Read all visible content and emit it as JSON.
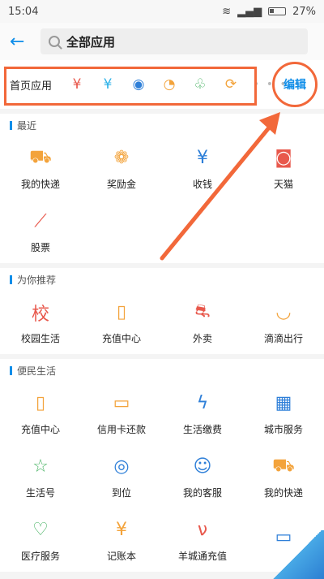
{
  "status_bar": {
    "time": "15:04",
    "battery": "27%"
  },
  "header": {
    "back_icon": "arrow-left-icon",
    "search_text": "全部应用"
  },
  "home_apps": {
    "label": "首页应用",
    "icons": [
      {
        "name": "money-bag-icon",
        "glyph": "¥",
        "color": "#e8584c"
      },
      {
        "name": "transfer-icon",
        "glyph": "¥",
        "color": "#2db2e8"
      },
      {
        "name": "phone-recharge-icon",
        "glyph": "◉",
        "color": "#2e7fd8"
      },
      {
        "name": "bean-icon",
        "glyph": "◔",
        "color": "#f3a33b"
      },
      {
        "name": "sprout-icon",
        "glyph": "♧",
        "color": "#4bb466"
      },
      {
        "name": "delivery-icon",
        "glyph": "⟳",
        "color": "#f3a33b"
      }
    ],
    "dots": "• • • •",
    "edit_label": "编辑"
  },
  "sections": [
    {
      "title": "最近",
      "items": [
        {
          "label": "我的快递",
          "icon": "truck-icon",
          "glyph": "⛟",
          "color": "#f3a33b"
        },
        {
          "label": "奖励金",
          "icon": "award-icon",
          "glyph": "❁",
          "color": "#f3a33b"
        },
        {
          "label": "收钱",
          "icon": "receive-money-icon",
          "glyph": "¥",
          "color": "#2e7fd8"
        },
        {
          "label": "天猫",
          "icon": "tmall-icon",
          "glyph": "◙",
          "color": "#e8584c"
        },
        {
          "label": "股票",
          "icon": "stock-chart-icon",
          "glyph": "⟋",
          "color": "#e8584c"
        }
      ]
    },
    {
      "title": "为你推荐",
      "items": [
        {
          "label": "校园生活",
          "icon": "campus-icon",
          "glyph": "校",
          "color": "#e8584c"
        },
        {
          "label": "充值中心",
          "icon": "phone-recharge-icon",
          "glyph": "▯",
          "color": "#f3a33b"
        },
        {
          "label": "外卖",
          "icon": "scooter-icon",
          "glyph": "⛐",
          "color": "#e8584c"
        },
        {
          "label": "滴滴出行",
          "icon": "didi-icon",
          "glyph": "◡",
          "color": "#f3a33b"
        }
      ]
    },
    {
      "title": "便民生活",
      "items": [
        {
          "label": "充值中心",
          "icon": "phone-recharge-icon",
          "glyph": "▯",
          "color": "#f3a33b"
        },
        {
          "label": "信用卡还款",
          "icon": "credit-card-icon",
          "glyph": "▭",
          "color": "#f3a33b"
        },
        {
          "label": "生活缴费",
          "icon": "utility-drop-icon",
          "glyph": "ϟ",
          "color": "#2e7fd8"
        },
        {
          "label": "城市服务",
          "icon": "building-icon",
          "glyph": "▦",
          "color": "#2e7fd8"
        },
        {
          "label": "生活号",
          "icon": "life-account-icon",
          "glyph": "☆",
          "color": "#4bb466"
        },
        {
          "label": "到位",
          "icon": "location-icon",
          "glyph": "◎",
          "color": "#2e7fd8"
        },
        {
          "label": "我的客服",
          "icon": "headset-icon",
          "glyph": "☺",
          "color": "#2e7fd8"
        },
        {
          "label": "我的快递",
          "icon": "truck-icon",
          "glyph": "⛟",
          "color": "#f3a33b"
        },
        {
          "label": "医疗服务",
          "icon": "medical-heart-icon",
          "glyph": "♡",
          "color": "#4bb466"
        },
        {
          "label": "记账本",
          "icon": "ledger-icon",
          "glyph": "¥",
          "color": "#f3a33b"
        },
        {
          "label": "羊城通充值",
          "icon": "transit-card-icon",
          "glyph": "ν",
          "color": "#e8584c"
        },
        {
          "label": "",
          "icon": "nfc-card-icon",
          "glyph": "▭",
          "color": "#2e7fd8"
        }
      ]
    }
  ]
}
